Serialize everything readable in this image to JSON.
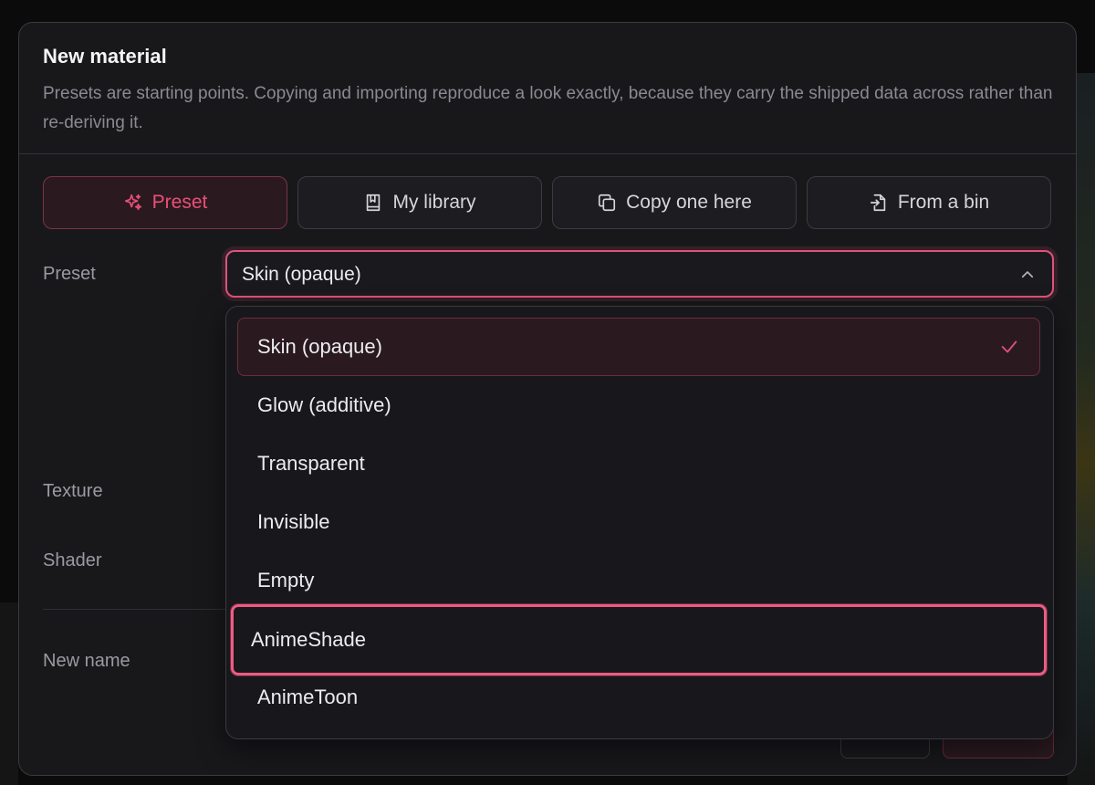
{
  "dialog": {
    "title": "New material",
    "subtitle": "Presets are starting points. Copying and importing reproduce a look exactly, because they carry the shipped data across rather than re-deriving it."
  },
  "tabs": [
    {
      "label": "Preset",
      "icon": "sparkle-icon",
      "active": true
    },
    {
      "label": "My library",
      "icon": "book-icon",
      "active": false
    },
    {
      "label": "Copy one here",
      "icon": "copy-icon",
      "active": false
    },
    {
      "label": "From a bin",
      "icon": "import-file-icon",
      "active": false
    }
  ],
  "form": {
    "preset_label": "Preset",
    "texture_label": "Texture",
    "shader_label": "Shader",
    "new_name_label": "New name"
  },
  "preset_select": {
    "value": "Skin (opaque)",
    "expanded": true,
    "options": [
      {
        "label": "Skin (opaque)",
        "selected": true
      },
      {
        "label": "Glow (additive)",
        "selected": false
      },
      {
        "label": "Transparent",
        "selected": false
      },
      {
        "label": "Invisible",
        "selected": false
      },
      {
        "label": "Empty",
        "selected": false
      },
      {
        "label": "AnimeShade",
        "selected": false,
        "hovered": true
      },
      {
        "label": "AnimeToon",
        "selected": false
      }
    ]
  },
  "colors": {
    "accent": "#ec4e79",
    "dialog_bg": "#18181b",
    "border": "#3a3a3f"
  }
}
